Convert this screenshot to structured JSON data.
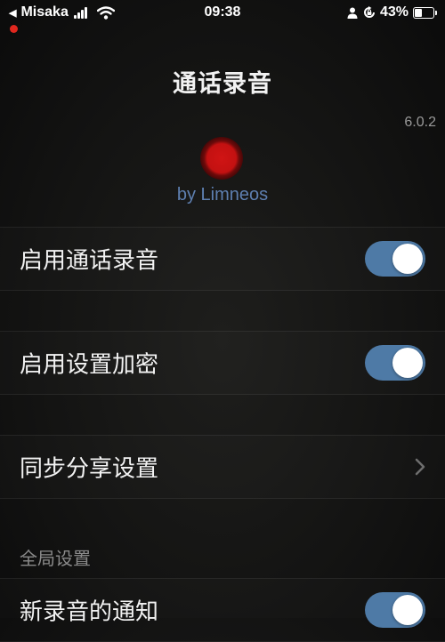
{
  "status_bar": {
    "back_arrow": "◀",
    "carrier": "Misaka",
    "time": "09:38",
    "battery_percent": "43%",
    "battery_level": 0.43
  },
  "header": {
    "title": "通话录音",
    "version": "6.0.2",
    "byline": "by Limneos",
    "accent_color": "#5e7fb0"
  },
  "settings": {
    "enable_recording": {
      "label": "启用通话录音",
      "on": true
    },
    "enable_encryption": {
      "label": "启用设置加密",
      "on": true
    },
    "sync_share": {
      "label": "同步分享设置"
    },
    "global_section_header": "全局设置",
    "new_recording_notification": {
      "label": "新录音的通知",
      "on": true
    }
  },
  "colors": {
    "toggle_on": "#4e7aa6",
    "recording_indicator": "#e0271e",
    "logo_red": "#c31111"
  }
}
